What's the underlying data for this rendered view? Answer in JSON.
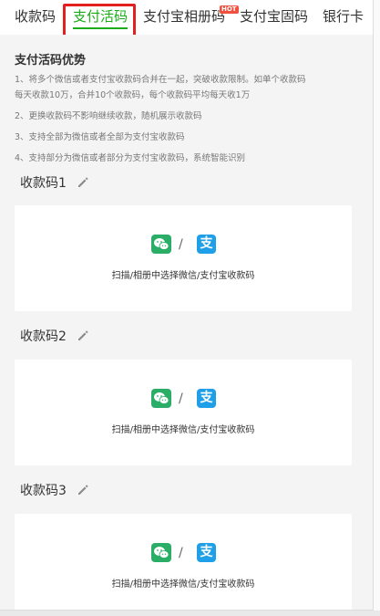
{
  "tabs": [
    {
      "label": "收款码",
      "active": false
    },
    {
      "label": "支付活码",
      "active": true
    },
    {
      "label": "支付宝相册码",
      "active": false,
      "badge": "HOT"
    },
    {
      "label": "支付宝固码",
      "active": false
    },
    {
      "label": "银行卡",
      "active": false
    }
  ],
  "advantages": {
    "title": "支付活码优势",
    "items": [
      "1、将多个微信或者支付宝收款码合并在一起，突破收款限制。如单个收款码",
      "每天收款10万，合并10个收款码，每个收款码平均每天收1万",
      "2、更换收款码不影响继续收款，随机展示收款码",
      "3、支持全部为微信或者全部为支付宝收款码",
      "4、支持部分为微信或者部分为支付宝收款码，系统智能识别"
    ]
  },
  "codes": [
    {
      "title": "收款码1",
      "slash": "/",
      "ali_glyph": "支",
      "label": "扫描/相册中选择微信/支付宝收款码"
    },
    {
      "title": "收款码2",
      "slash": "/",
      "ali_glyph": "支",
      "label": "扫描/相册中选择微信/支付宝收款码"
    },
    {
      "title": "收款码3",
      "slash": "/",
      "ali_glyph": "支",
      "label": "扫描/相册中选择微信/支付宝收款码"
    }
  ],
  "colors": {
    "accent": "#1aad19",
    "highlight": "#e2201e",
    "wechat": "#2aae67",
    "alipay": "#1e9fe8"
  }
}
